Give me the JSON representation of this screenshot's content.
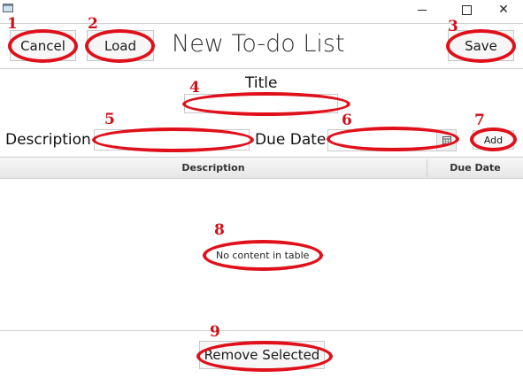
{
  "window": {
    "app_icon": "window-icon",
    "controls": {
      "minimize_icon": "minimize-icon",
      "maximize_icon": "maximize-icon",
      "close_symbol": "✕"
    }
  },
  "toolbar": {
    "cancel_label": "Cancel",
    "load_label": "Load",
    "title": "New To-do List",
    "save_label": "Save"
  },
  "form": {
    "title_label": "Title",
    "title_value": "",
    "description_label": "Description",
    "description_value": "",
    "due_date_label": "Due Date",
    "due_date_value": "",
    "calendar_icon": "calendar-icon",
    "add_label": "Add"
  },
  "table": {
    "columns": [
      "Description",
      "Due Date"
    ],
    "rows": [],
    "empty_message": "No content in table"
  },
  "footer": {
    "remove_label": "Remove Selected"
  },
  "annotations": {
    "color": "#e0101a",
    "markers": [
      "1",
      "2",
      "3",
      "4",
      "5",
      "6",
      "7",
      "8",
      "9"
    ]
  }
}
